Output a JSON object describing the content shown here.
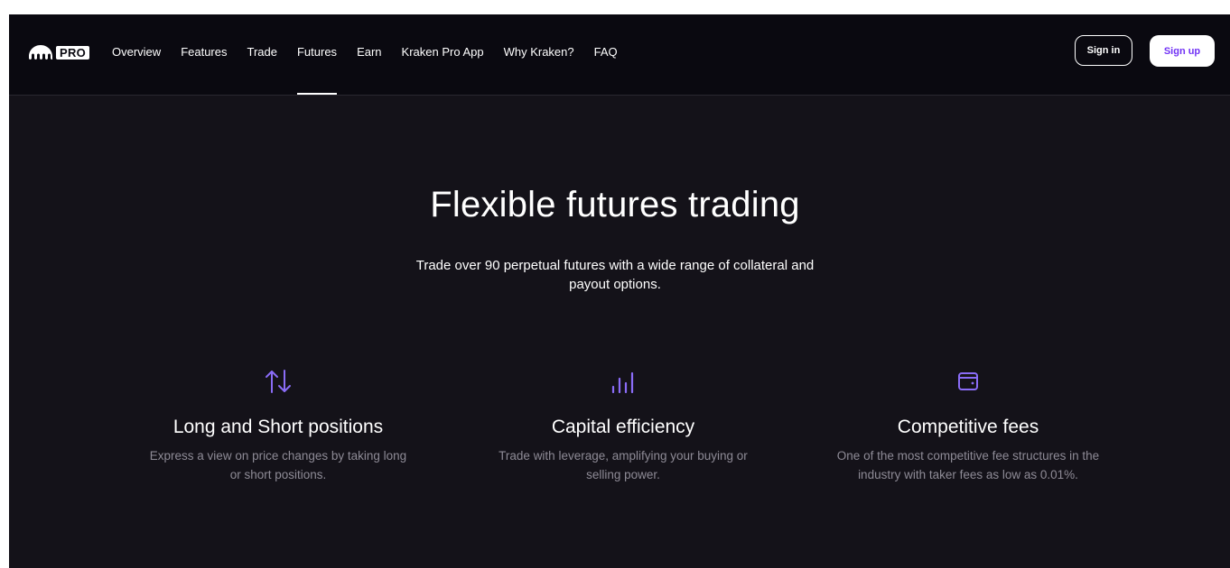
{
  "nav": {
    "logo_badge": "PRO",
    "links": [
      "Overview",
      "Features",
      "Trade",
      "Futures",
      "Earn",
      "Kraken Pro App",
      "Why Kraken?",
      "FAQ"
    ],
    "active_link": "Futures",
    "sign_in": "Sign in",
    "sign_up": "Sign up"
  },
  "hero": {
    "title": "Flexible futures trading",
    "subtitle": "Trade over 90 perpetual futures with a wide range of collateral and payout options."
  },
  "features": [
    {
      "icon": "arrows-up-down-icon",
      "title": "Long and Short positions",
      "description": "Express a view on price changes by taking long or short positions."
    },
    {
      "icon": "bar-chart-icon",
      "title": "Capital efficiency",
      "description": "Trade with leverage, amplifying your buying or selling power."
    },
    {
      "icon": "wallet-icon",
      "title": "Competitive fees",
      "description": "One of the most competitive fee structures in the industry with taker fees as low as 0.01%."
    }
  ],
  "colors": {
    "background": "#141219",
    "nav_background": "#0a0910",
    "accent": "#7132f5",
    "icon_color": "#8a6cf7",
    "muted_text": "#8e8b96"
  }
}
